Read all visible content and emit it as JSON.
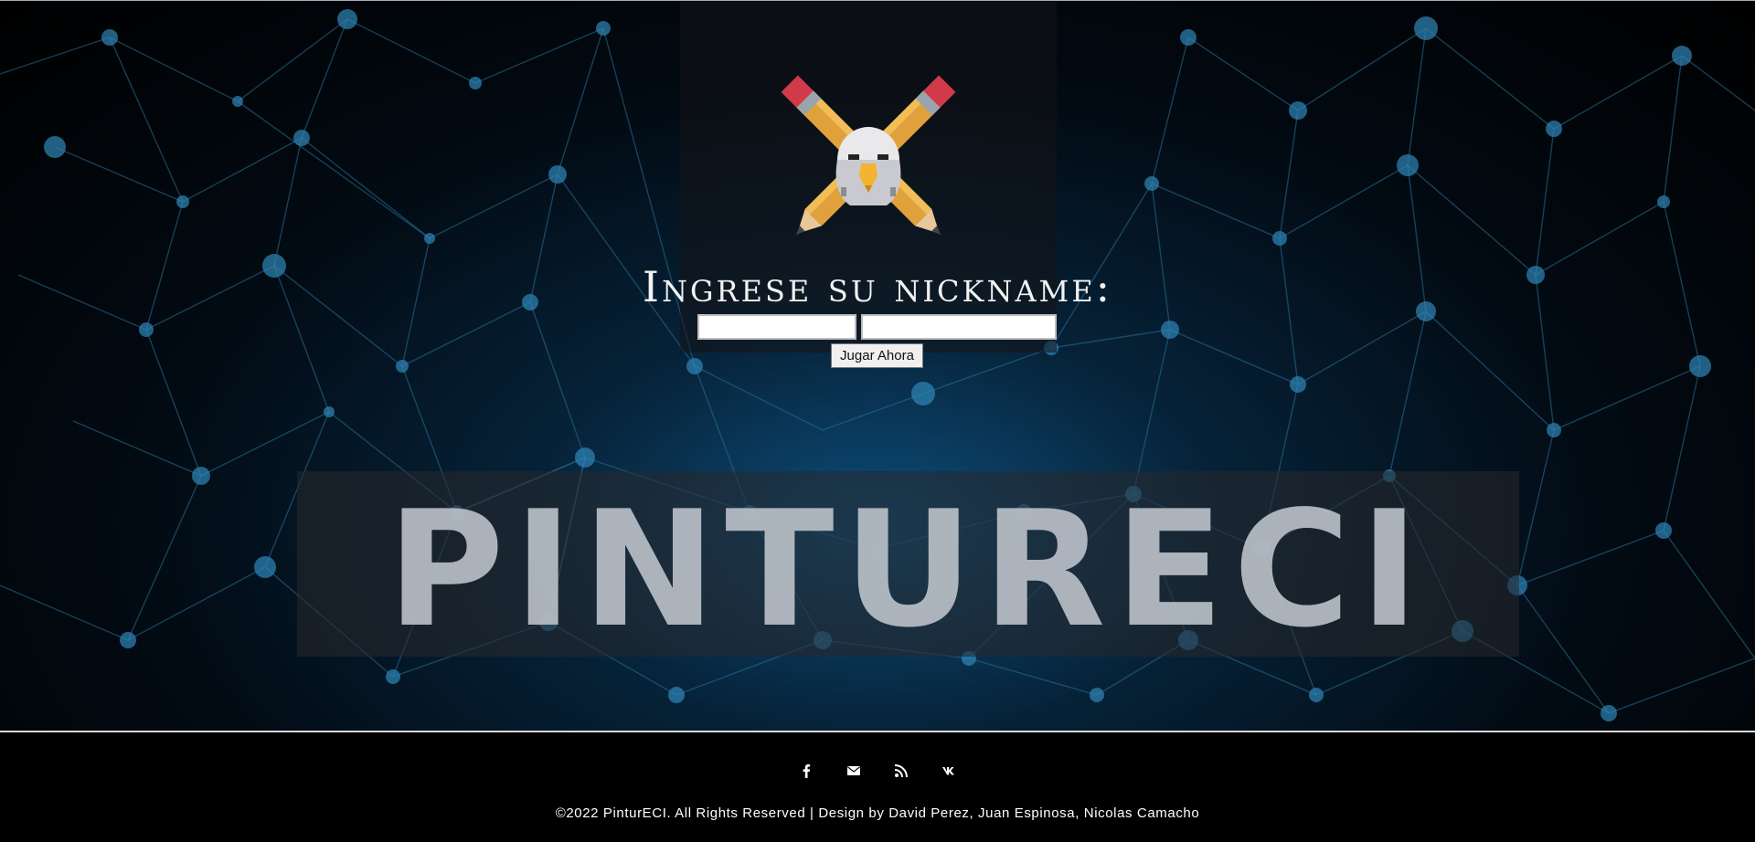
{
  "brand": {
    "name": "PINTURECI",
    "logo_icon": "eagle-crossed-pencils-icon"
  },
  "login": {
    "label": "Ingrese su nickname:",
    "field1_value": "",
    "field2_value": "",
    "play_label": "Jugar Ahora"
  },
  "footer": {
    "socials": [
      "facebook-icon",
      "mail-icon",
      "rss-icon",
      "vk-icon"
    ],
    "copyright": "©2022 PinturECI. All Rights Reserved | Design by David Perez, Juan Espinosa, Nicolas Camacho"
  },
  "colors": {
    "background": "#000000",
    "network": "#2a6f96",
    "banner_text": "#b9bfc7",
    "pencil": "#e0a13a",
    "eraser": "#d03a4a"
  }
}
